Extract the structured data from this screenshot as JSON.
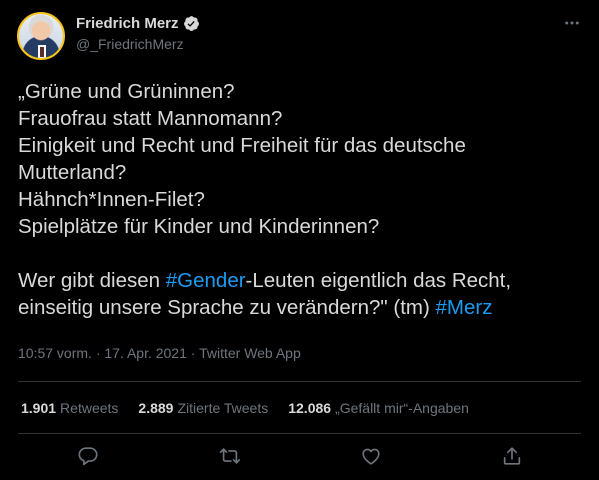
{
  "author": {
    "display_name": "Friedrich Merz",
    "handle": "@_FriedrichMerz"
  },
  "icons": {
    "verified": "verified-badge-icon",
    "more": "more-options-icon",
    "reply": "reply-icon",
    "retweet": "retweet-icon",
    "like": "like-icon",
    "share": "share-icon"
  },
  "tweet": {
    "lines": [
      "„Grüne und Grüninnen?",
      "Frauofrau statt Mannomann?",
      "Einigkeit und Recht und Freiheit für das deutsche",
      "Mutterland?",
      "Hähnch*Innen-Filet?",
      "Spielplätze für Kinder und Kinderinnen?"
    ],
    "para2_part1": "Wer gibt diesen ",
    "hashtag1": "#Gender",
    "para2_part2": "-Leuten eigentlich das Recht,",
    "para2_line2": "einseitig unsere Sprache zu verändern?\" (tm) ",
    "hashtag2": "#Merz"
  },
  "meta": "10:57 vorm. · 17. Apr. 2021 · Twitter Web App",
  "stats": {
    "retweets_count": "1.901",
    "retweets_label": "Retweets",
    "quotes_count": "2.889",
    "quotes_label": "Zitierte Tweets",
    "likes_count": "12.086",
    "likes_label": "„Gefällt mir“-Angaben"
  },
  "colors": {
    "background": "#000000",
    "text": "#d9d9d9",
    "secondary": "#6e767d",
    "link": "#1d9bf0",
    "divider": "#2f3336",
    "verified": "#d9d9d9"
  }
}
